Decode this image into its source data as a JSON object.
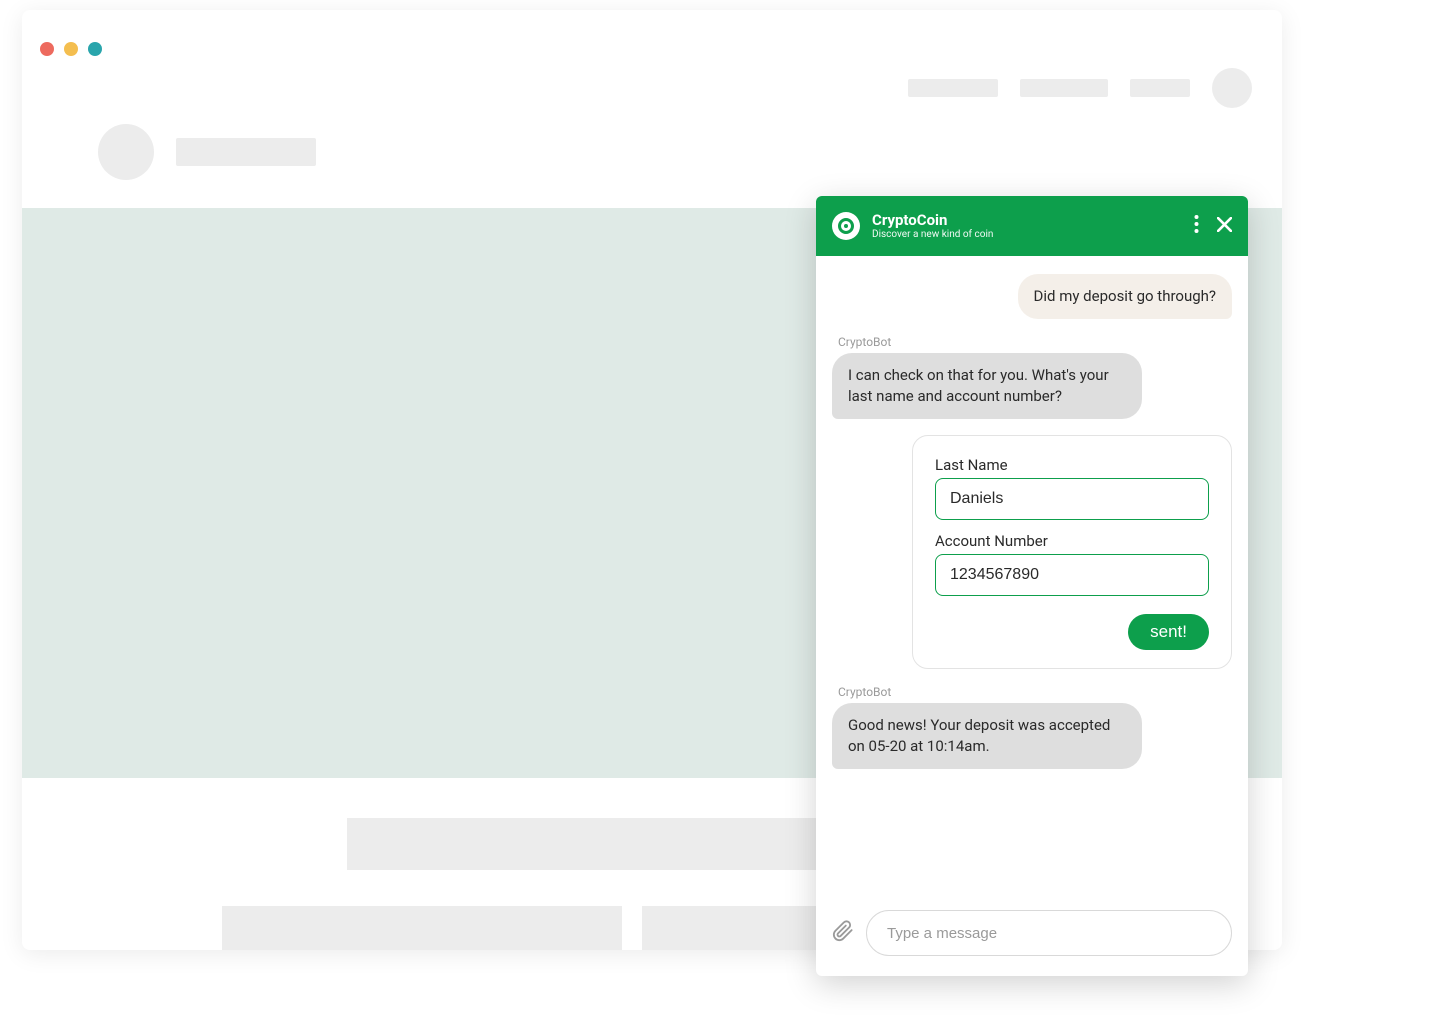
{
  "window": {
    "controls": {
      "close": "#ed6a5e",
      "minimize": "#f4be4f",
      "maximize": "#29a5ac"
    }
  },
  "chat": {
    "header": {
      "brandColor": "#0d9f4c",
      "title": "CryptoCoin",
      "subtitle": "Discover a new kind of coin"
    },
    "messages": {
      "user1": "Did my deposit go through?",
      "botName": "CryptoBot",
      "bot1": "I can check on that for you. What's your last name and account number?",
      "bot2": "Good news! Your deposit was accepted on 05-20 at 10:14am."
    },
    "form": {
      "lastNameLabel": "Last Name",
      "lastNameValue": "Daniels",
      "accountLabel": "Account Number",
      "accountValue": "1234567890",
      "sentLabel": "sent!"
    },
    "input": {
      "placeholder": "Type a message"
    }
  }
}
